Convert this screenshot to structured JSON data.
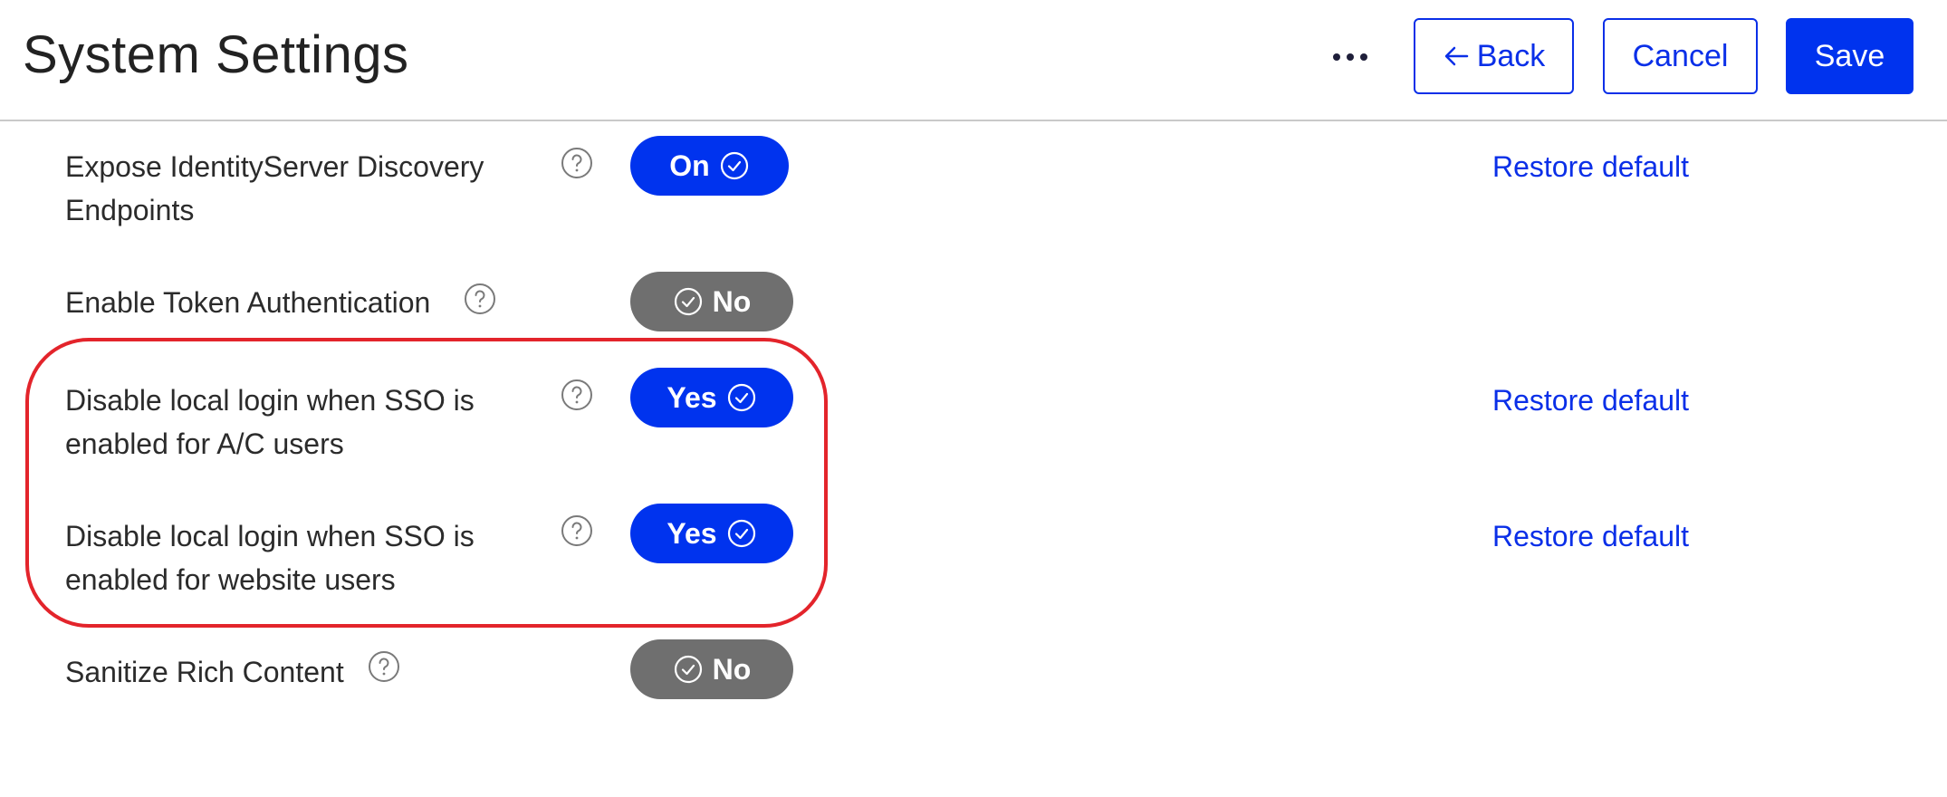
{
  "header": {
    "title": "System Settings",
    "back_label": "Back",
    "cancel_label": "Cancel",
    "save_label": "Save"
  },
  "settings": [
    {
      "label_lines": [
        "Expose IdentityServer Discovery",
        "Endpoints"
      ],
      "value": "On",
      "state": "on",
      "restore": "Restore default"
    },
    {
      "label_lines": [
        "Enable Token Authentication"
      ],
      "value": "No",
      "state": "off",
      "restore": ""
    },
    {
      "label_lines": [
        "Disable local login when SSO is",
        "enabled for A/C users"
      ],
      "value": "Yes",
      "state": "on",
      "restore": "Restore default"
    },
    {
      "label_lines": [
        "Disable local login when SSO is",
        "enabled for website users"
      ],
      "value": "Yes",
      "state": "on",
      "restore": "Restore default"
    },
    {
      "label_lines": [
        "Sanitize Rich Content"
      ],
      "value": "No",
      "state": "off",
      "restore": ""
    }
  ],
  "colors": {
    "accent": "#0033ee",
    "toggle_off": "#6f6f6f",
    "highlight": "#e3242b"
  }
}
